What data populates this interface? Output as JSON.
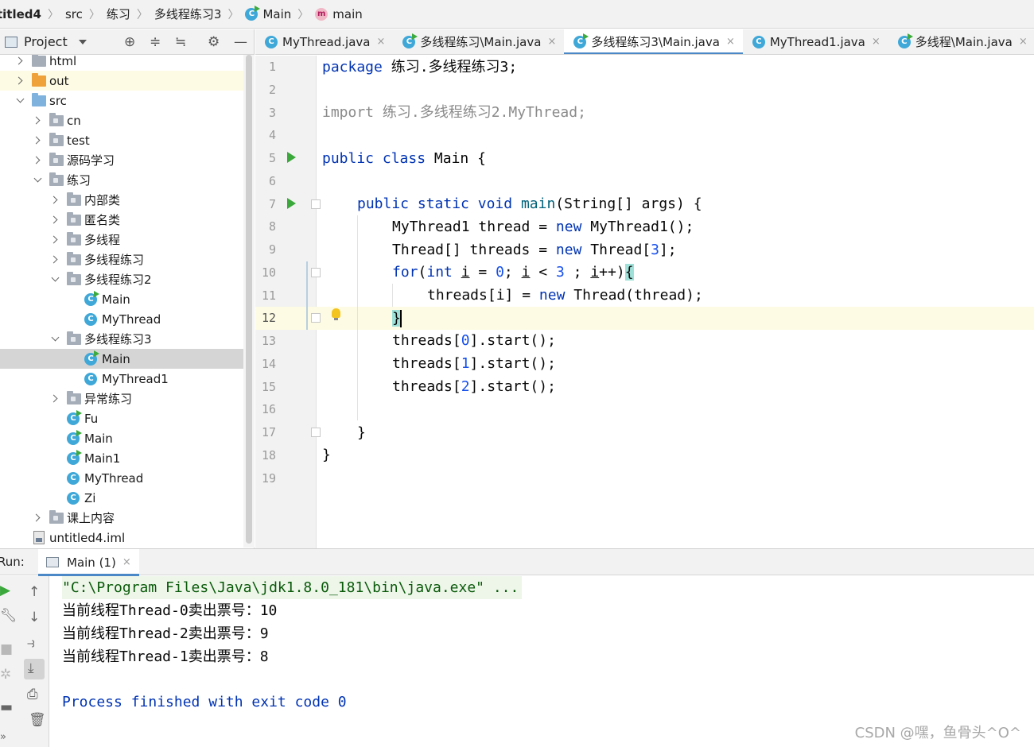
{
  "breadcrumb": {
    "items": [
      "titled4",
      "src",
      "练习",
      "多线程练习3",
      "Main",
      "main"
    ],
    "class_icon": "C",
    "method_icon": "m"
  },
  "project": {
    "title": "Project",
    "tree": [
      {
        "label": "html",
        "indent": 1,
        "arrow": "right",
        "icon": "folder"
      },
      {
        "label": "out",
        "indent": 1,
        "arrow": "right",
        "icon": "folder-orange",
        "state": "highlight"
      },
      {
        "label": "src",
        "indent": 1,
        "arrow": "down",
        "icon": "folder-blue"
      },
      {
        "label": "cn",
        "indent": 2,
        "arrow": "right",
        "icon": "package"
      },
      {
        "label": "test",
        "indent": 2,
        "arrow": "right",
        "icon": "package"
      },
      {
        "label": "源码学习",
        "indent": 2,
        "arrow": "right",
        "icon": "package"
      },
      {
        "label": "练习",
        "indent": 2,
        "arrow": "down",
        "icon": "package"
      },
      {
        "label": "内部类",
        "indent": 3,
        "arrow": "right",
        "icon": "package"
      },
      {
        "label": "匿名类",
        "indent": 3,
        "arrow": "right",
        "icon": "package"
      },
      {
        "label": "多线程",
        "indent": 3,
        "arrow": "right",
        "icon": "package"
      },
      {
        "label": "多线程练习",
        "indent": 3,
        "arrow": "right",
        "icon": "package"
      },
      {
        "label": "多线程练习2",
        "indent": 3,
        "arrow": "down",
        "icon": "package"
      },
      {
        "label": "Main",
        "indent": 4,
        "arrow": "none",
        "icon": "class-run"
      },
      {
        "label": "MyThread",
        "indent": 4,
        "arrow": "none",
        "icon": "class"
      },
      {
        "label": "多线程练习3",
        "indent": 3,
        "arrow": "down",
        "icon": "package"
      },
      {
        "label": "Main",
        "indent": 4,
        "arrow": "none",
        "icon": "class-run",
        "state": "selected"
      },
      {
        "label": "MyThread1",
        "indent": 4,
        "arrow": "none",
        "icon": "class"
      },
      {
        "label": "异常练习",
        "indent": 3,
        "arrow": "right",
        "icon": "package"
      },
      {
        "label": "Fu",
        "indent": 3,
        "arrow": "none",
        "icon": "class-run"
      },
      {
        "label": "Main",
        "indent": 3,
        "arrow": "none",
        "icon": "class-run"
      },
      {
        "label": "Main1",
        "indent": 3,
        "arrow": "none",
        "icon": "class-run"
      },
      {
        "label": "MyThread",
        "indent": 3,
        "arrow": "none",
        "icon": "class"
      },
      {
        "label": "Zi",
        "indent": 3,
        "arrow": "none",
        "icon": "class"
      },
      {
        "label": "课上内容",
        "indent": 2,
        "arrow": "right",
        "icon": "package"
      },
      {
        "label": "untitled4.iml",
        "indent": 1,
        "arrow": "none",
        "icon": "file"
      }
    ]
  },
  "tabs": [
    {
      "label": "MyThread.java",
      "icon": "class"
    },
    {
      "label": "多线程练习\\Main.java",
      "icon": "class-run"
    },
    {
      "label": "多线程练习3\\Main.java",
      "icon": "class-run",
      "active": true
    },
    {
      "label": "MyThread1.java",
      "icon": "class"
    },
    {
      "label": "多线程\\Main.java",
      "icon": "class-run"
    }
  ],
  "tab_close_glyph": "×",
  "editor": {
    "current_line": 12,
    "lines": [
      "1",
      "2",
      "3",
      "4",
      "5",
      "6",
      "7",
      "8",
      "9",
      "10",
      "11",
      "12",
      "13",
      "14",
      "15",
      "16",
      "17",
      "18",
      "19"
    ],
    "code": {
      "l1_kw": "package",
      "l1_rest": " 练习.多线程练习3;",
      "l3_kw": "import",
      "l3_rest": " 练习.多线程练习2.MyThread;",
      "l5_kw1": "public",
      "l5_kw2": "class",
      "l5_rest": " Main {",
      "l7_kw1": "public",
      "l7_kw2": "static",
      "l7_kw3": "void",
      "l7_name": " main",
      "l7_rest": "(String[] args) {",
      "l8_a": "MyThread1 thread = ",
      "l8_kw": "new",
      "l8_b": " MyThread1();",
      "l9_a": "Thread[] threads = ",
      "l9_kw": "new",
      "l9_b": " Thread[",
      "l9_num": "3",
      "l9_c": "];",
      "l10_kw": "for",
      "l10_a": "(",
      "l10_kw2": "int",
      "l10_b": " ",
      "l10_i1": "i",
      "l10_c": " = ",
      "l10_n0": "0",
      "l10_d": "; ",
      "l10_i2": "i",
      "l10_e": " < ",
      "l10_n3": "3",
      "l10_f": " ; ",
      "l10_i3": "i",
      "l10_g": "++)",
      "l10_brace": "{",
      "l11_a": "threads[i] = ",
      "l11_kw": "new",
      "l11_b": " Thread(thread);",
      "l12_brace": "}",
      "l13_a": "threads[",
      "l13_n": "0",
      "l13_b": "].start();",
      "l14_a": "threads[",
      "l14_n": "1",
      "l14_b": "].start();",
      "l15_a": "threads[",
      "l15_n": "2",
      "l15_b": "].start();",
      "l17": "}",
      "l18": "}"
    }
  },
  "run": {
    "label": "Run:",
    "tab_label": "Main (1)",
    "tab_close": "×",
    "console": [
      "\"C:\\Program Files\\Java\\jdk1.8.0_181\\bin\\java.exe\" ...",
      "当前线程Thread-0卖出票号：10",
      "当前线程Thread-2卖出票号：9",
      "当前线程Thread-1卖出票号：8",
      "",
      "Process finished with exit code 0"
    ]
  },
  "watermark": "CSDN @嘿，鱼骨头^O^",
  "colors": {
    "keyword": "#0033b3",
    "number": "#1750eb",
    "accent": "#4a88c7",
    "run_green": "#3aa83a",
    "class_icon": "#3fa8d8"
  }
}
